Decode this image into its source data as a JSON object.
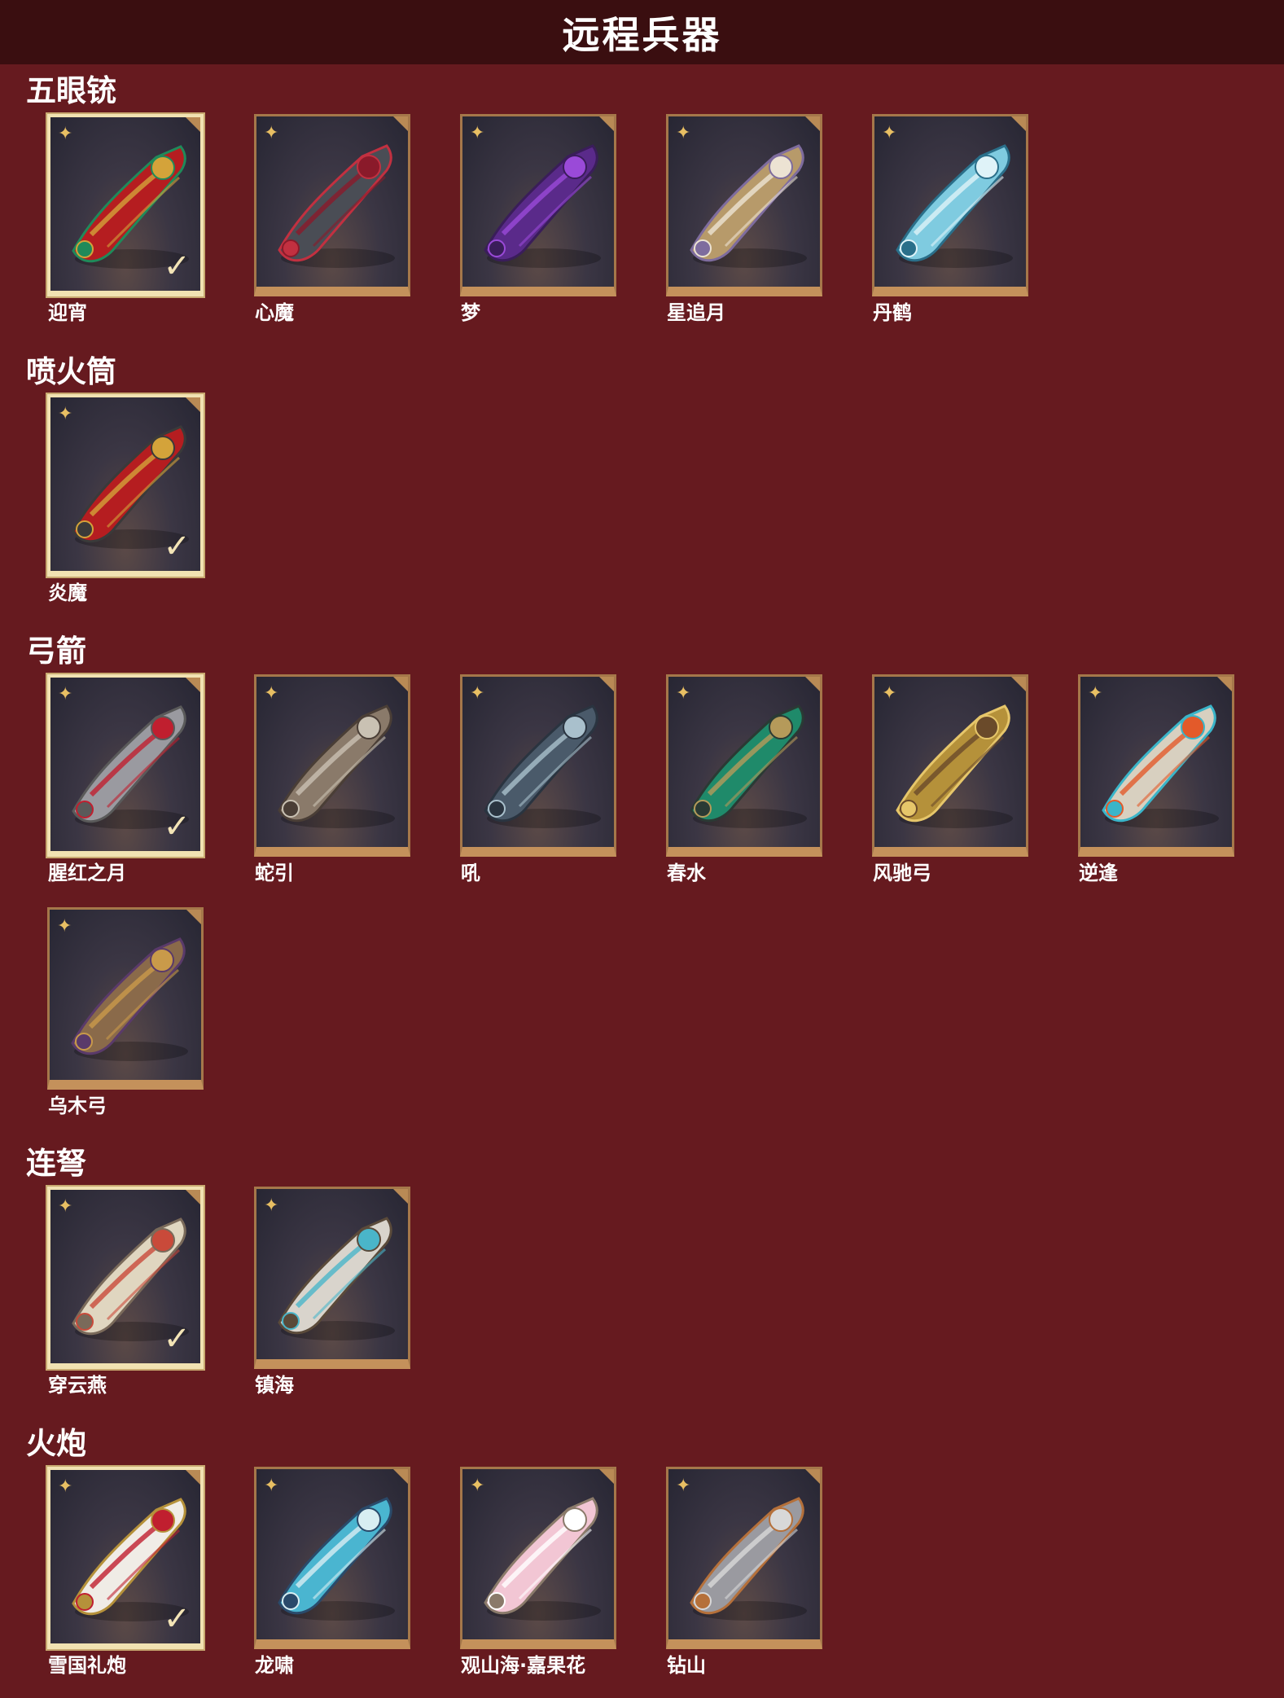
{
  "page": {
    "title": "远程兵器"
  },
  "icons": {
    "rarity": "four-point-star-icon",
    "selected": "checkmark-icon",
    "corner": "corner-tab-icon"
  },
  "sections": [
    {
      "title": "五眼铳",
      "items": [
        {
          "name": "迎宵",
          "selected": true,
          "colors": [
            "#b51d20",
            "#d4a33a",
            "#1f8a5a"
          ]
        },
        {
          "name": "心魔",
          "selected": false,
          "colors": [
            "#4a4d55",
            "#8a1a2a",
            "#c23040"
          ]
        },
        {
          "name": "梦",
          "selected": false,
          "colors": [
            "#5a2a8a",
            "#9a4ad8",
            "#3a1d5a"
          ]
        },
        {
          "name": "星追月",
          "selected": false,
          "colors": [
            "#b79a6a",
            "#ece3d3",
            "#7e6c9e"
          ]
        },
        {
          "name": "丹鹤",
          "selected": false,
          "colors": [
            "#7fcbe0",
            "#dff3f8",
            "#2a6f8a"
          ]
        }
      ]
    },
    {
      "title": "喷火筒",
      "items": [
        {
          "name": "炎魔",
          "selected": true,
          "colors": [
            "#b51d20",
            "#d4a33a",
            "#3a3a3a"
          ]
        }
      ]
    },
    {
      "title": "弓箭",
      "items": [
        {
          "name": "腥红之月",
          "selected": true,
          "colors": [
            "#9a9aa0",
            "#c01f2f",
            "#5a5a5a"
          ]
        },
        {
          "name": "蛇引",
          "selected": false,
          "colors": [
            "#8a7a6a",
            "#c9c1b3",
            "#4a3e36"
          ]
        },
        {
          "name": "吼",
          "selected": false,
          "colors": [
            "#4a5a6a",
            "#a9c0cc",
            "#2a3440"
          ]
        },
        {
          "name": "春水",
          "selected": false,
          "colors": [
            "#1f8a6a",
            "#b59a5a",
            "#2a3a34"
          ]
        },
        {
          "name": "风驰弓",
          "selected": false,
          "colors": [
            "#b5913a",
            "#6a4a2a",
            "#e6c66a"
          ]
        },
        {
          "name": "逆逢",
          "selected": false,
          "colors": [
            "#d8d0c0",
            "#e35a2a",
            "#3ab5c9"
          ]
        },
        {
          "name": "乌木弓",
          "selected": false,
          "colors": [
            "#8a6a4a",
            "#c99a4a",
            "#5a3a6a"
          ]
        }
      ]
    },
    {
      "title": "连弩",
      "items": [
        {
          "name": "穿云燕",
          "selected": true,
          "colors": [
            "#e0d6c0",
            "#c94a3a",
            "#7a6a5a"
          ]
        },
        {
          "name": "镇海",
          "selected": false,
          "colors": [
            "#d9d4cc",
            "#4ab5c9",
            "#5a4a3a"
          ]
        }
      ]
    },
    {
      "title": "火炮",
      "items": [
        {
          "name": "雪国礼炮",
          "selected": true,
          "colors": [
            "#f0ece6",
            "#c01f2f",
            "#b5913a"
          ]
        },
        {
          "name": "龙啸",
          "selected": false,
          "colors": [
            "#4ab5d0",
            "#d8eef2",
            "#2a4a6a"
          ]
        },
        {
          "name": "观山海·嘉果花",
          "selected": false,
          "colors": [
            "#f2c6d4",
            "#ffffff",
            "#8a7a6a"
          ]
        },
        {
          "name": "钻山",
          "selected": false,
          "colors": [
            "#9a9aa0",
            "#d8d8d8",
            "#b5703a"
          ]
        }
      ]
    }
  ]
}
